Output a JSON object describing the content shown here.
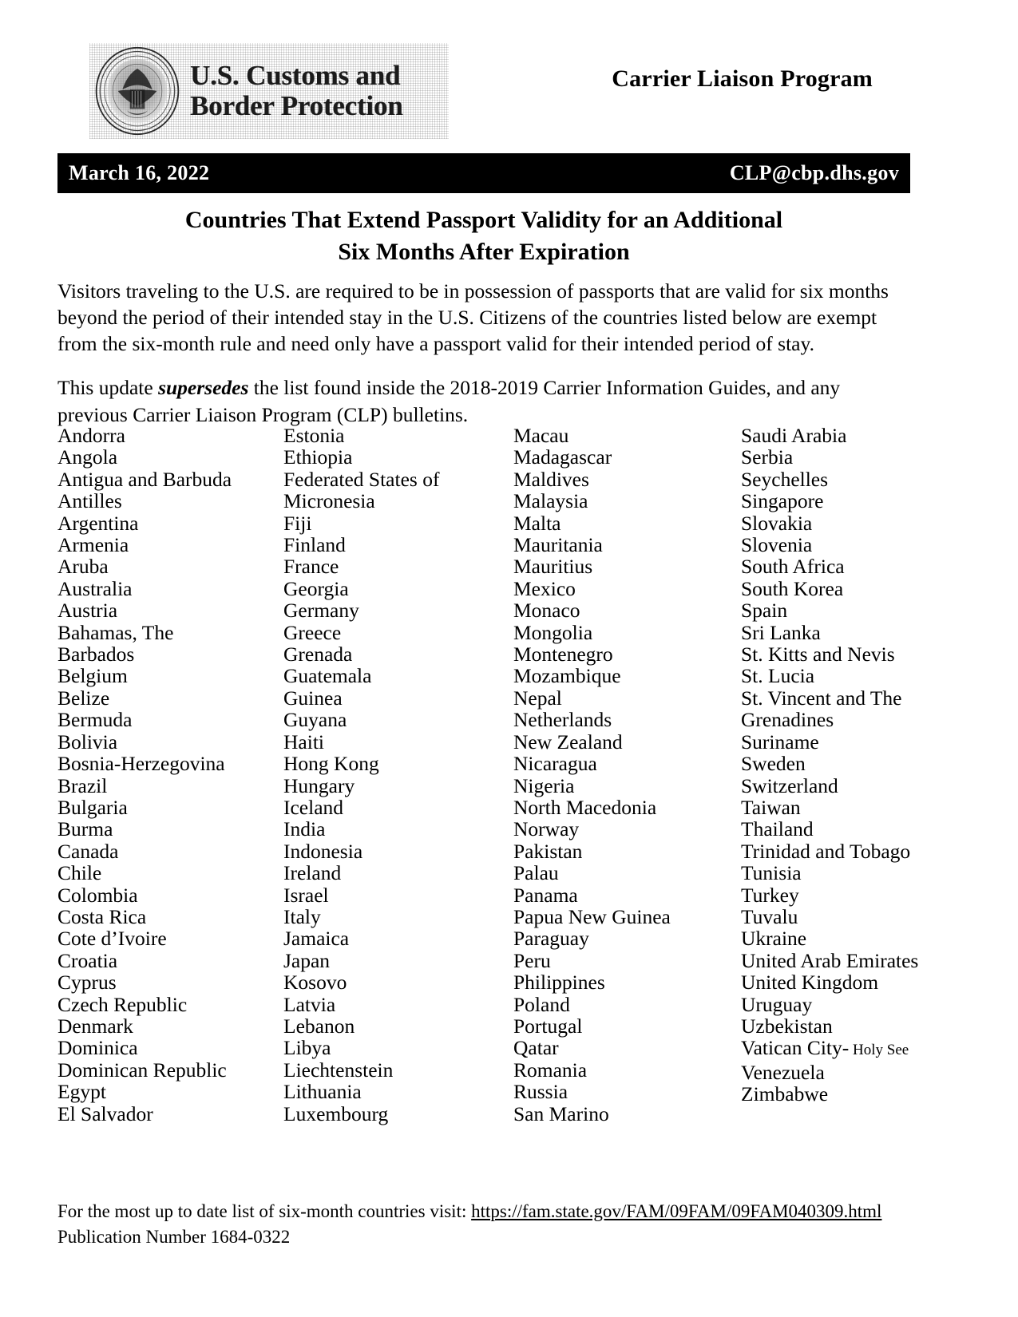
{
  "masthead": {
    "agency_line_1": "U.S. Customs and",
    "agency_line_2": "Border Protection",
    "seal_icon": "cbp-seal-icon",
    "program_title": "Carrier Liaison Program"
  },
  "info_bar": {
    "date": "March 16, 2022",
    "email": "CLP@cbp.dhs.gov",
    "background_color": "#000000",
    "text_color": "#ffffff"
  },
  "headline": {
    "line_1": "Countries That Extend Passport Validity for an Additional",
    "line_2": "Six Months After Expiration"
  },
  "body": {
    "paragraph_1_a": "Visitors traveling to the U.S. are required to be in possession of passports that are valid for six months beyond the period of their intended stay in the U.S.  Citizens of the countries listed below are exempt from the six-month rule and need only have a passport valid for their intended period of stay.",
    "paragraph_2_a": "This update ",
    "paragraph_2_emphasis": "supersedes",
    "paragraph_2_b": " the list found inside the 2018-2019 Carrier Information Guides, and any previous Carrier Liaison Program (CLP) bulletins."
  },
  "countries": {
    "column_1": [
      "Andorra",
      "Angola",
      "Antigua and Barbuda",
      "Antilles",
      "Argentina",
      "Armenia",
      "Aruba",
      "Australia",
      "Austria",
      "Bahamas, The",
      "Barbados",
      "Belgium",
      "Belize",
      "Bermuda",
      "Bolivia",
      "Bosnia-Herzegovina",
      "Brazil",
      "Bulgaria",
      "Burma",
      "Canada",
      "Chile",
      "Colombia",
      "Costa Rica",
      "Cote d’Ivoire",
      "Croatia",
      "Cyprus",
      "Czech Republic",
      "Denmark",
      "Dominica",
      "Dominican Republic",
      "Egypt",
      "El Salvador"
    ],
    "column_2": [
      "Estonia",
      "Ethiopia",
      "Federated States of",
      "Micronesia",
      "Fiji",
      "Finland",
      "France",
      "Georgia",
      "Germany",
      "Greece",
      "Grenada",
      "Guatemala",
      "Guinea",
      "Guyana",
      "Haiti",
      "Hong Kong",
      "Hungary",
      "Iceland",
      "India",
      "Indonesia",
      "Ireland",
      "Israel",
      "Italy",
      "Jamaica",
      "Japan",
      "Kosovo",
      "Latvia",
      "Lebanon",
      "Libya",
      "Liechtenstein",
      "Lithuania",
      "Luxembourg"
    ],
    "column_3": [
      "Macau",
      "Madagascar",
      "Maldives",
      "Malaysia",
      "Malta",
      "Mauritania",
      "Mauritius",
      "Mexico",
      "Monaco",
      "Mongolia",
      "Montenegro",
      "Mozambique",
      "Nepal",
      "Netherlands",
      "New Zealand",
      "Nicaragua",
      "Nigeria",
      "North Macedonia",
      "Norway",
      "Pakistan",
      "Palau",
      "Panama",
      "Papua New Guinea",
      "Paraguay",
      "Peru",
      "Philippines",
      "Poland",
      "Portugal",
      "Qatar",
      "Romania",
      "Russia",
      "San Marino"
    ],
    "column_4": [
      "Saudi Arabia",
      "Serbia",
      "Seychelles",
      "Singapore",
      "Slovakia",
      "Slovenia",
      "South Africa",
      "South Korea",
      "Spain",
      "Sri Lanka",
      "St. Kitts and Nevis",
      "St. Lucia",
      "St. Vincent and The",
      "Grenadines",
      "Suriname",
      "Sweden",
      "Switzerland",
      "Taiwan",
      "Thailand",
      "Trinidad and Tobago",
      "Tunisia",
      "Turkey",
      "Tuvalu",
      "Ukraine",
      "United Arab Emirates",
      "United Kingdom",
      "Uruguay",
      "Uzbekistan",
      "Vatican City- Holy See",
      "Venezuela",
      "Zimbabwe"
    ]
  },
  "footer": {
    "note_prefix": "For the most up to date list of six-month countries visit: ",
    "url": "https://fam.state.gov/FAM/09FAM/09FAM040309.html",
    "publication": "Publication Number 1684-0322"
  }
}
